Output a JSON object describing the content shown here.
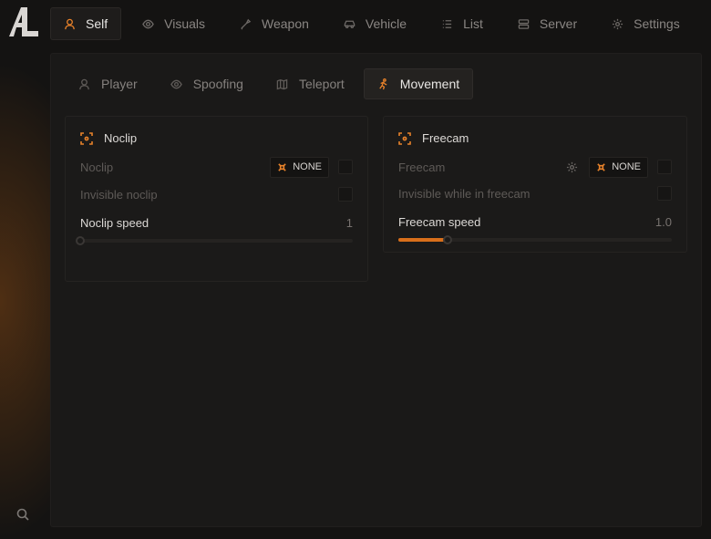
{
  "top_tabs": [
    {
      "label": "Self",
      "icon": "user-icon",
      "active": true
    },
    {
      "label": "Visuals",
      "icon": "eye-icon"
    },
    {
      "label": "Weapon",
      "icon": "wrench-icon"
    },
    {
      "label": "Vehicle",
      "icon": "car-icon"
    },
    {
      "label": "List",
      "icon": "list-icon"
    },
    {
      "label": "Server",
      "icon": "server-icon"
    },
    {
      "label": "Settings",
      "icon": "gear-icon"
    }
  ],
  "sub_tabs": [
    {
      "label": "Player",
      "icon": "user-icon"
    },
    {
      "label": "Spoofing",
      "icon": "eye-icon"
    },
    {
      "label": "Teleport",
      "icon": "map-icon"
    },
    {
      "label": "Movement",
      "icon": "running-icon",
      "active": true
    }
  ],
  "noclip": {
    "title": "Noclip",
    "toggle_label": "Noclip",
    "keybind": "NONE",
    "invisible_label": "Invisible noclip",
    "speed_label": "Noclip speed",
    "speed_value": "1",
    "speed_fraction": 0.0
  },
  "freecam": {
    "title": "Freecam",
    "toggle_label": "Freecam",
    "keybind": "NONE",
    "invisible_label": "Invisible while in freecam",
    "speed_label": "Freecam speed",
    "speed_value": "1.0",
    "speed_fraction": 0.18
  },
  "colors": {
    "accent": "#e8822a",
    "background": "#141312"
  }
}
